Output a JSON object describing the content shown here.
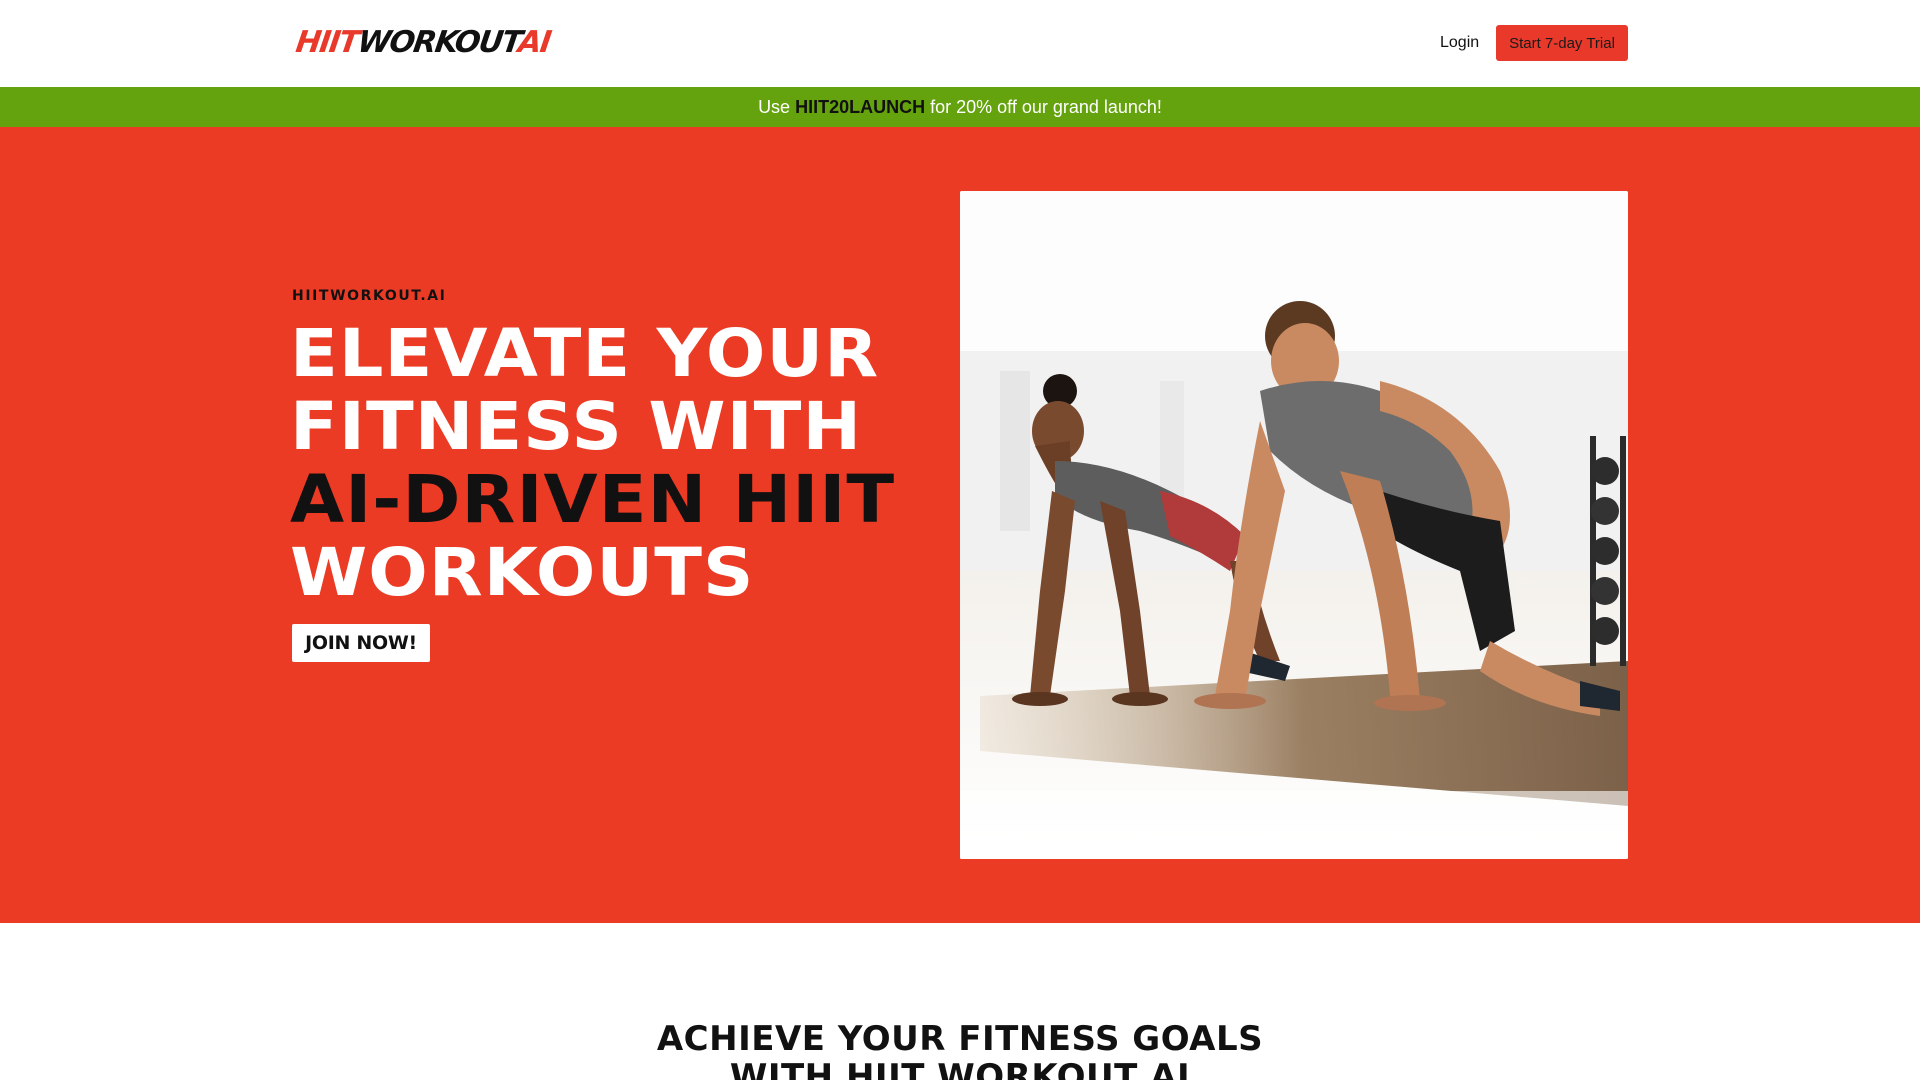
{
  "header": {
    "logo": {
      "part1": "HIIT",
      "part2": "WORKOUT",
      "part3": "AI"
    },
    "login_label": "Login",
    "trial_label": "Start 7-day Trial"
  },
  "promo": {
    "prefix": "Use ",
    "code": "HIIT20LAUNCH",
    "suffix": " for 20% off our grand launch!"
  },
  "hero": {
    "eyebrow": "HIITWORKOUT.AI",
    "headline_lines": [
      "ELEVATE YOUR",
      "FITNESS WITH",
      "AI-DRIVEN HIIT",
      "WORKOUTS"
    ],
    "cta_label": "JOIN NOW!",
    "image_icon": "workout-photo-icon"
  },
  "section": {
    "title_line1": "ACHIEVE YOUR FITNESS GOALS",
    "title_line2": "WITH HIIT WORKOUT AI"
  },
  "colors": {
    "brand_red": "#ec3b25",
    "promo_green": "#64a30d",
    "text_dark": "#111111"
  }
}
